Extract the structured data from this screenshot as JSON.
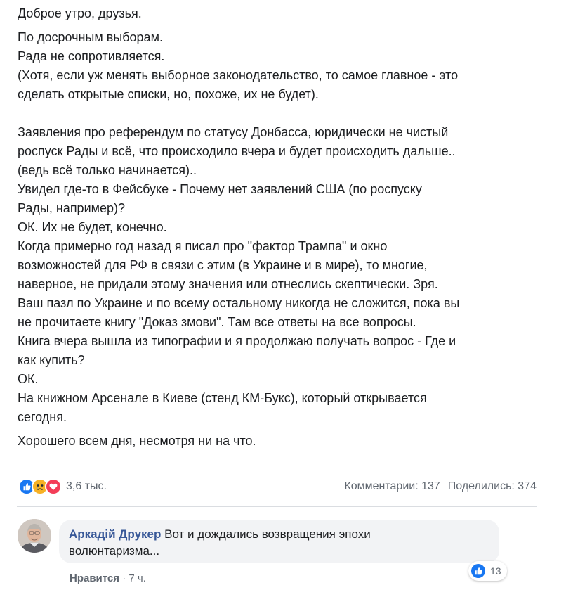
{
  "post": {
    "greeting": "Доброе утро, друзья.",
    "elections": [
      "По досрочным выборам.",
      "Рада не сопротивляется.",
      "(Хотя, если уж менять выборное законодательство, то самое главное - это",
      "сделать открытые списки, но, похоже, их не будет)."
    ],
    "statements": [
      "Заявления про референдум по статусу Донбасса, юридически не чистый",
      "роспуск Рады и всё, что происходило вчера и будет происходить дальше..",
      "(ведь всё только начинается)..",
      "Увидел где-то в Фейсбуке - Почему нет заявлений США (по роспуску",
      "Рады, например)?",
      "ОК. Их не будет, конечно.",
      "Когда примерно год назад я писал про \"фактор Трампа\" и окно",
      "возможностей для РФ в связи с этим (в Украине и в мире), то многие,",
      "наверное, не придали этому значения или отнеслись скептически. Зря.",
      "Ваш пазл по Украине и по всему остальному никогда не сложится, пока вы",
      "не прочитаете книгу \"Доказ змови\". Там все ответы на все вопросы.",
      "Книга вчера вышла из типографии и я продолжаю получать вопрос - Где и",
      "как купить?",
      "ОК.",
      "На книжном Арсенале в Киеве (стенд КМ-Букс), который открывается",
      "сегодня."
    ],
    "closing": "Хорошего всем дня, несмотря ни на что."
  },
  "stats": {
    "reaction_icons": [
      "like-icon",
      "sad-icon",
      "love-icon"
    ],
    "reactions_count": "3,6 тыс.",
    "comments": "Комментарии: 137",
    "shares": "Поделились: 374"
  },
  "comment": {
    "author": "Аркадій Друкер",
    "text_line1": "Вот и дождались возвращения эпохи",
    "text_line2": "волюнтаризма...",
    "likes": "13",
    "like_label": "Нравится",
    "separator": "·",
    "time": "7 ч."
  },
  "colors": {
    "like": "#1877f2",
    "sad": "#f7b125",
    "love": "#f33e58",
    "author": "#385898",
    "muted": "#606770"
  }
}
